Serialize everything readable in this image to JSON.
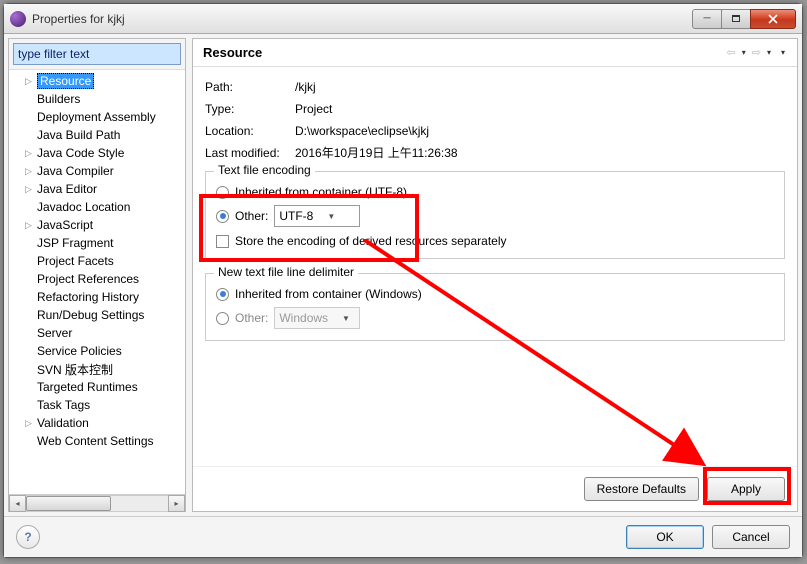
{
  "window": {
    "title": "Properties for kjkj"
  },
  "sidebar": {
    "filter_placeholder": "type filter text",
    "items": [
      {
        "label": "Resource",
        "expander": "▷",
        "selected": true,
        "lvl": 1
      },
      {
        "label": "Builders",
        "expander": "",
        "lvl": 1
      },
      {
        "label": "Deployment Assembly",
        "expander": "",
        "lvl": 1
      },
      {
        "label": "Java Build Path",
        "expander": "",
        "lvl": 1
      },
      {
        "label": "Java Code Style",
        "expander": "▷",
        "lvl": 1
      },
      {
        "label": "Java Compiler",
        "expander": "▷",
        "lvl": 1
      },
      {
        "label": "Java Editor",
        "expander": "▷",
        "lvl": 1
      },
      {
        "label": "Javadoc Location",
        "expander": "",
        "lvl": 1
      },
      {
        "label": "JavaScript",
        "expander": "▷",
        "lvl": 1
      },
      {
        "label": "JSP Fragment",
        "expander": "",
        "lvl": 1
      },
      {
        "label": "Project Facets",
        "expander": "",
        "lvl": 1
      },
      {
        "label": "Project References",
        "expander": "",
        "lvl": 1
      },
      {
        "label": "Refactoring History",
        "expander": "",
        "lvl": 1
      },
      {
        "label": "Run/Debug Settings",
        "expander": "",
        "lvl": 1
      },
      {
        "label": "Server",
        "expander": "",
        "lvl": 1
      },
      {
        "label": "Service Policies",
        "expander": "",
        "lvl": 1
      },
      {
        "label": "SVN 版本控制",
        "expander": "",
        "lvl": 1
      },
      {
        "label": "Targeted Runtimes",
        "expander": "",
        "lvl": 1
      },
      {
        "label": "Task Tags",
        "expander": "",
        "lvl": 1
      },
      {
        "label": "Validation",
        "expander": "▷",
        "lvl": 1
      },
      {
        "label": "Web Content Settings",
        "expander": "",
        "lvl": 1
      }
    ]
  },
  "content": {
    "title": "Resource",
    "info": {
      "path_label": "Path:",
      "path_value": "/kjkj",
      "type_label": "Type:",
      "type_value": "Project",
      "location_label": "Location:",
      "location_value": "D:\\workspace\\eclipse\\kjkj",
      "modified_label": "Last modified:",
      "modified_value": "2016年10月19日 上午11:26:38"
    },
    "encoding": {
      "group_title": "Text file encoding",
      "inherited_label": "Inherited from container (UTF-8)",
      "other_label": "Other:",
      "other_value": "UTF-8",
      "store_label": "Store the encoding of derived resources separately"
    },
    "delimiter": {
      "group_title": "New text file line delimiter",
      "inherited_label": "Inherited from container (Windows)",
      "other_label": "Other:",
      "other_value": "Windows"
    },
    "buttons": {
      "restore": "Restore Defaults",
      "apply": "Apply"
    }
  },
  "bottom": {
    "ok": "OK",
    "cancel": "Cancel"
  }
}
